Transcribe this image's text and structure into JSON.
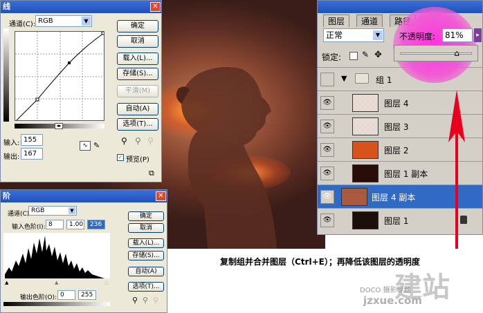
{
  "curves": {
    "title": "线",
    "channel_label": "通道(C):",
    "channel_value": "RGB",
    "input_label": "输入:",
    "input_value": "155",
    "output_label": "输出:",
    "output_value": "167",
    "buttons": [
      "确定",
      "取消",
      "载入(L)...",
      "存储(S)...",
      "平滑(M)",
      "自动(A)",
      "选项(T)..."
    ],
    "preview_label": "预览(P)"
  },
  "levels": {
    "title": "阶",
    "channel_label": "通道(C):",
    "channel_value": "RGB",
    "input_levels_label": "输入色阶(I):",
    "input_levels": [
      "8",
      "1.00",
      "236"
    ],
    "output_levels_label": "输出色阶(O):",
    "output_levels": [
      "0",
      "255"
    ],
    "buttons": [
      "确定",
      "取消",
      "载入(L)...",
      "存储(S)...",
      "自动(A)",
      "选项(T)..."
    ]
  },
  "layers": {
    "tabs": [
      "图层",
      "通道",
      "路径"
    ],
    "blend_mode": "正常",
    "opacity_label": "不透明度:",
    "opacity_value": "81%",
    "opacity_level": 0.81,
    "lock_label": "锁定:",
    "rows": [
      {
        "name": "组 1",
        "type": "group"
      },
      {
        "name": "图层 4",
        "type": "layer"
      },
      {
        "name": "图层 3",
        "type": "layer"
      },
      {
        "name": "图层 2",
        "type": "layer"
      },
      {
        "name": "图层 1 副本",
        "type": "layer"
      },
      {
        "name": "图层 4 副本",
        "type": "layer",
        "selected": true
      },
      {
        "name": "图层 1",
        "type": "layer",
        "locked": true
      }
    ]
  },
  "caption": "复制组并合并图层（Ctrl+E）；再降低该图层的透明度",
  "watermark": {
    "big": "建站",
    "small": "DOCO 摄影专题",
    "url": "jzxue.com"
  },
  "colors": {
    "accent": "#316ac5",
    "arrow": "#e8001e",
    "highlight": "#ff33e0"
  }
}
